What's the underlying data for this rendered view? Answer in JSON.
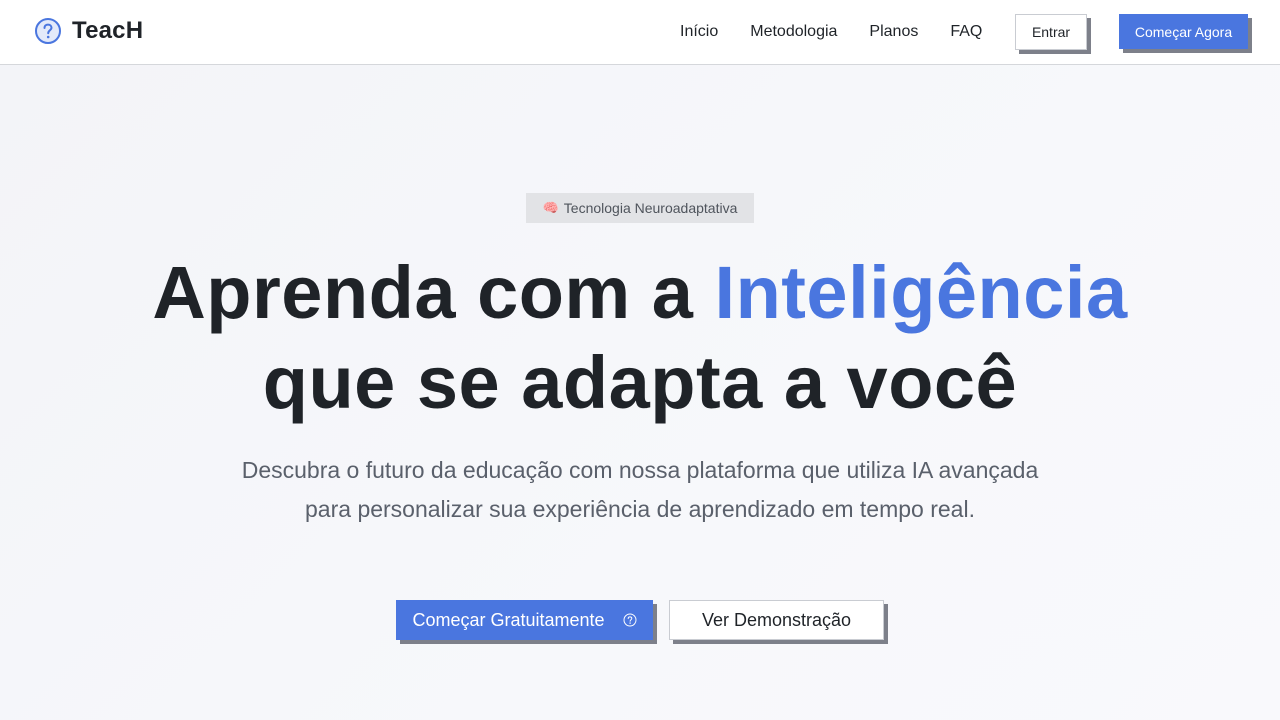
{
  "brand": {
    "name": "TeacH",
    "icon": "question-circle-icon",
    "accent_color": "#4a76df"
  },
  "nav": {
    "links": [
      {
        "label": "Início"
      },
      {
        "label": "Metodologia"
      },
      {
        "label": "Planos"
      },
      {
        "label": "FAQ"
      }
    ],
    "login_label": "Entrar",
    "start_label": "Começar Agora"
  },
  "hero": {
    "badge": {
      "icon": "brain-icon",
      "label": "Tecnologia Neuroadaptativa"
    },
    "headline_part1": "Aprenda com a ",
    "headline_accent": "Inteligência",
    "headline_part2": "que se adapta a você",
    "subtitle": "Descubra o futuro da educação com nossa plataforma que utiliza IA avançada para personalizar sua experiência de aprendizado em tempo real.",
    "primary_cta": {
      "label": "Começar Gratuitamente",
      "icon": "question-circle-icon"
    },
    "secondary_cta": {
      "label": "Ver Demonstração"
    }
  },
  "colors": {
    "primary": "#4a76df",
    "text": "#1f2328",
    "muted": "#5a606b",
    "shadow": "#7d808a"
  }
}
